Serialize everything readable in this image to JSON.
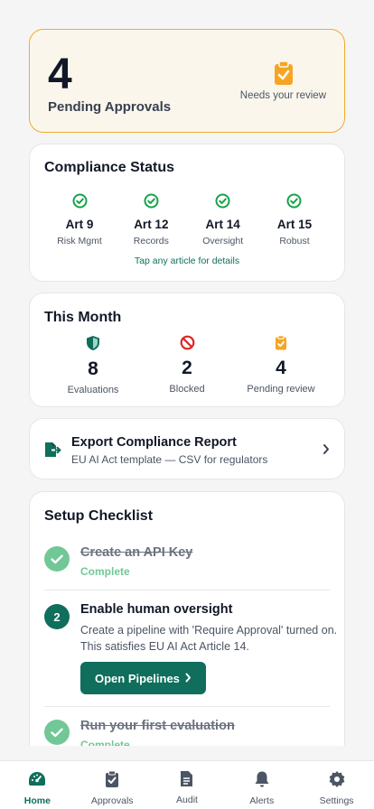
{
  "pending": {
    "count": "4",
    "label": "Pending Approvals",
    "hint": "Needs your review"
  },
  "compliance": {
    "title": "Compliance Status",
    "articles": [
      {
        "name": "Art 9",
        "sub": "Risk Mgmt"
      },
      {
        "name": "Art 12",
        "sub": "Records"
      },
      {
        "name": "Art 14",
        "sub": "Oversight"
      },
      {
        "name": "Art 15",
        "sub": "Robust"
      }
    ],
    "tap_hint": "Tap any article for details"
  },
  "month": {
    "title": "This Month",
    "stats": [
      {
        "value": "8",
        "label": "Evaluations"
      },
      {
        "value": "2",
        "label": "Blocked"
      },
      {
        "value": "4",
        "label": "Pending review"
      }
    ]
  },
  "export": {
    "title": "Export Compliance Report",
    "subtitle": "EU AI Act template — CSV for regulators"
  },
  "checklist": {
    "title": "Setup Checklist",
    "steps": [
      {
        "title": "Create an API Key",
        "status": "Complete"
      },
      {
        "number": "2",
        "title": "Enable human oversight",
        "desc": "Create a pipeline with 'Require Approval' turned on. This satisfies EU AI Act Article 14.",
        "button": "Open Pipelines"
      },
      {
        "title": "Run your first evaluation",
        "status": "Complete"
      }
    ]
  },
  "nav": [
    {
      "label": "Home"
    },
    {
      "label": "Approvals"
    },
    {
      "label": "Audit"
    },
    {
      "label": "Alerts"
    },
    {
      "label": "Settings"
    }
  ],
  "colors": {
    "accent": "#0f6e5c",
    "amber": "#f5a524",
    "success": "#72c796",
    "danger": "#dc2626"
  },
  "icons": {
    "pending": "clipboard-check-icon",
    "article": "check-circle-icon",
    "evaluations": "shield-icon",
    "blocked": "ban-icon",
    "export": "file-export-icon",
    "chevron": "chevron-right-icon"
  }
}
